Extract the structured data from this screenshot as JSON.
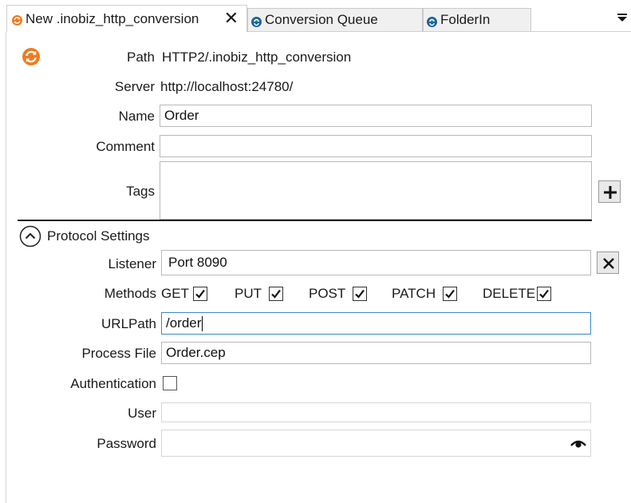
{
  "tabs": [
    {
      "label": "New .inobiz_http_conversion",
      "active": true,
      "close": "✕"
    },
    {
      "label": "Conversion Queue",
      "active": false
    },
    {
      "label": "FolderIn",
      "active": false
    }
  ],
  "form": {
    "path_label": "Path",
    "path_value": "HTTP2/.inobiz_http_conversion",
    "server_label": "Server",
    "server_value": "http://localhost:24780/",
    "name_label": "Name",
    "name_value": "Order",
    "comment_label": "Comment",
    "comment_value": "",
    "tags_label": "Tags",
    "tags_value": ""
  },
  "protocol": {
    "section_label": "Protocol Settings",
    "listener_label": "Listener",
    "listener_value": "Port 8090",
    "methods_label": "Methods",
    "methods": [
      {
        "label": "GET",
        "checked": true
      },
      {
        "label": "PUT",
        "checked": true
      },
      {
        "label": "POST",
        "checked": true
      },
      {
        "label": "PATCH",
        "checked": true
      },
      {
        "label": "DELETE",
        "checked": true
      }
    ],
    "urlpath_label": "URLPath",
    "urlpath_value": "/order",
    "process_file_label": "Process File",
    "process_file_value": "Order.cep",
    "authentication_label": "Authentication",
    "authentication_checked": false,
    "user_label": "User",
    "user_value": "",
    "password_label": "Password",
    "password_value": ""
  },
  "colors": {
    "accent_orange": "#F07B1E",
    "queue_icon_green": "#2E9E3E",
    "queue_icon_blue": "#1F5FA8",
    "focus_blue": "#3D86D0"
  },
  "icons": {
    "tab_icon": "refresh-circle-icon",
    "header_icon": "refresh-circle-icon",
    "add_tag": "plus-icon",
    "clear_listener": "close-icon",
    "collapse": "chevron-up-circle-icon",
    "password_reveal": "eye-icon",
    "overflow": "dropdown-arrow-icon"
  }
}
